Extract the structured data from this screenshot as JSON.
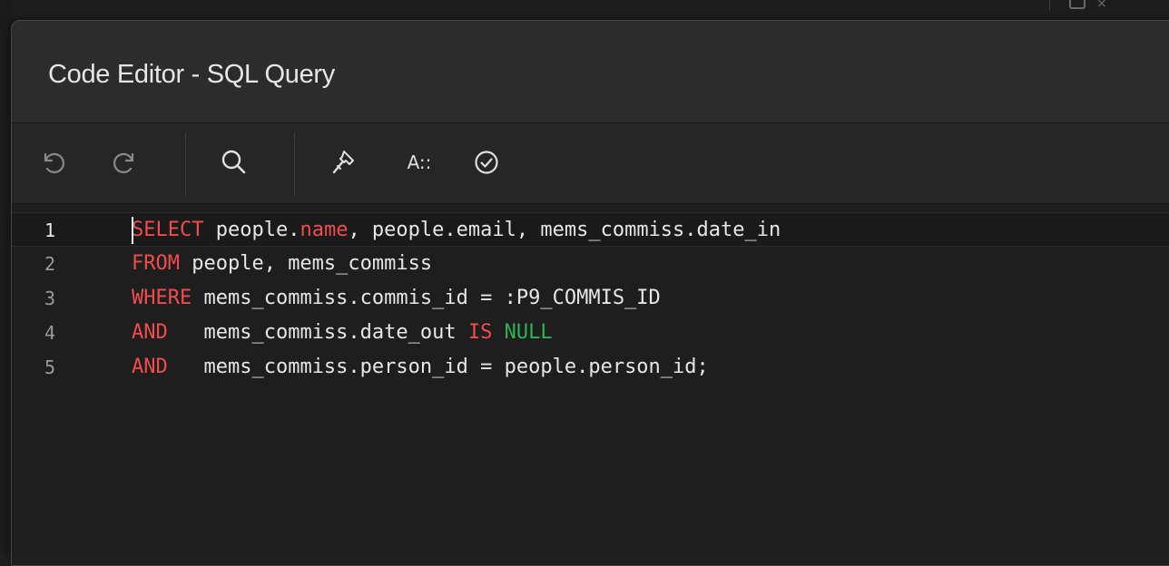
{
  "dialog": {
    "title": "Code Editor - SQL Query"
  },
  "toolbar": {
    "undo_icon": "undo-icon",
    "redo_icon": "redo-icon",
    "search_icon": "search-icon",
    "format_icon": "hammer-icon",
    "font_label": "A::",
    "validate_icon": "check-circle-icon"
  },
  "editor": {
    "lines": [
      {
        "number": "1",
        "tokens": [
          {
            "t": "SELECT",
            "c": "kw"
          },
          {
            "t": " people.",
            "c": "plain"
          },
          {
            "t": "name",
            "c": "kw"
          },
          {
            "t": ", people.email, mems_commiss.date_in",
            "c": "plain"
          }
        ]
      },
      {
        "number": "2",
        "tokens": [
          {
            "t": "FROM",
            "c": "kw"
          },
          {
            "t": " people, mems_commiss",
            "c": "plain"
          }
        ]
      },
      {
        "number": "3",
        "tokens": [
          {
            "t": "WHERE",
            "c": "kw"
          },
          {
            "t": " mems_commiss.commis_id = :P9_COMMIS_ID",
            "c": "plain"
          }
        ]
      },
      {
        "number": "4",
        "tokens": [
          {
            "t": "AND",
            "c": "kw"
          },
          {
            "t": "   mems_commiss.date_out ",
            "c": "plain"
          },
          {
            "t": "IS",
            "c": "kw"
          },
          {
            "t": " ",
            "c": "plain"
          },
          {
            "t": "NULL",
            "c": "lit"
          }
        ]
      },
      {
        "number": "5",
        "tokens": [
          {
            "t": "AND",
            "c": "kw"
          },
          {
            "t": "   mems_commiss.person_id = people.person_id;",
            "c": "plain"
          }
        ]
      }
    ]
  },
  "colors": {
    "keyword": "#f14c4c",
    "literal": "#2fb354",
    "text": "#e6e6e6",
    "header_bg": "#2c2c2c",
    "editor_bg": "#1e1e1e"
  }
}
